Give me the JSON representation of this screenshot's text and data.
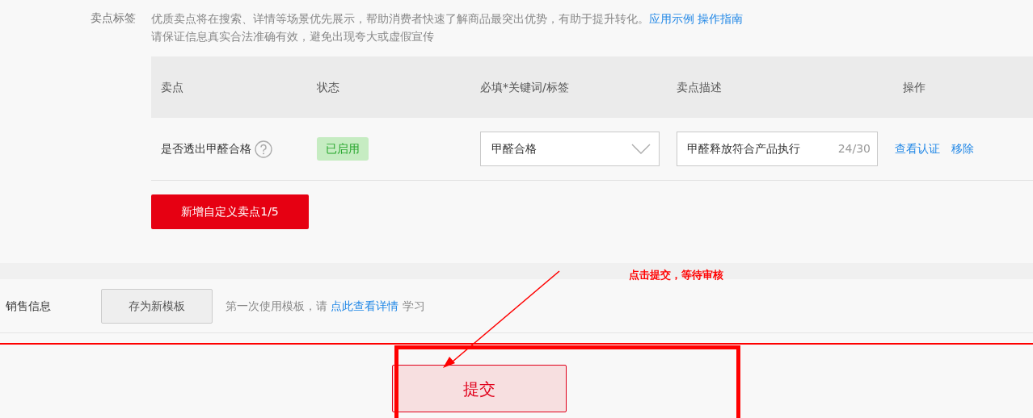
{
  "selling_points": {
    "label": "卖点标签",
    "description": "优质卖点将在搜索、详情等场景优先展示，帮助消费者快速了解商品最突出优势，有助于提升转化。",
    "links": [
      "应用示例",
      "操作指南"
    ],
    "note": "请保证信息真实合法准确有效，避免出现夸大或虚假宣传",
    "table": {
      "columns": [
        "卖点",
        "状态",
        "必填*关键词/标签",
        "卖点描述",
        "操作"
      ],
      "rows": [
        {
          "name": "是否透出甲醛合格",
          "status": "已启用",
          "enabled": true,
          "keyword": "甲醛合格",
          "description_value": "甲醛释放符合产品执行",
          "counter": "24/30",
          "actions": [
            "查看认证",
            "移除"
          ]
        }
      ]
    },
    "add_button": "新增自定义卖点1/5"
  },
  "annotation": {
    "text": "点击提交，等待审核"
  },
  "sales_info": {
    "label": "销售信息",
    "button": "存为新模板",
    "hint_prefix": "第一次使用模板，请 ",
    "hint_link": "点此查看详情",
    "hint_suffix": " 学习"
  },
  "submit_button": "提交"
}
